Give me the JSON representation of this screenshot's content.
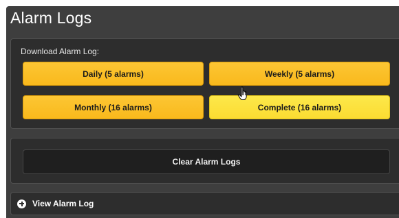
{
  "page": {
    "title": "Alarm Logs"
  },
  "download": {
    "label": "Download Alarm Log:",
    "buttons": [
      {
        "label": "Daily (5 alarms)"
      },
      {
        "label": "Weekly (5 alarms)"
      },
      {
        "label": "Monthly (16 alarms)"
      },
      {
        "label": "Complete (16 alarms)"
      }
    ]
  },
  "clear": {
    "label": "Clear Alarm Logs"
  },
  "view": {
    "label": "View Alarm Log",
    "icon": "plus-circle-icon"
  },
  "colors": {
    "panel_bg": "#3e3e3e",
    "box_bg": "#2d2d2d",
    "button_yellow": "#fbbf24",
    "button_yellow_hover": "#fde047",
    "button_dark": "#1f1f1f"
  },
  "cursor": {
    "icon": "hand-pointer-icon"
  }
}
